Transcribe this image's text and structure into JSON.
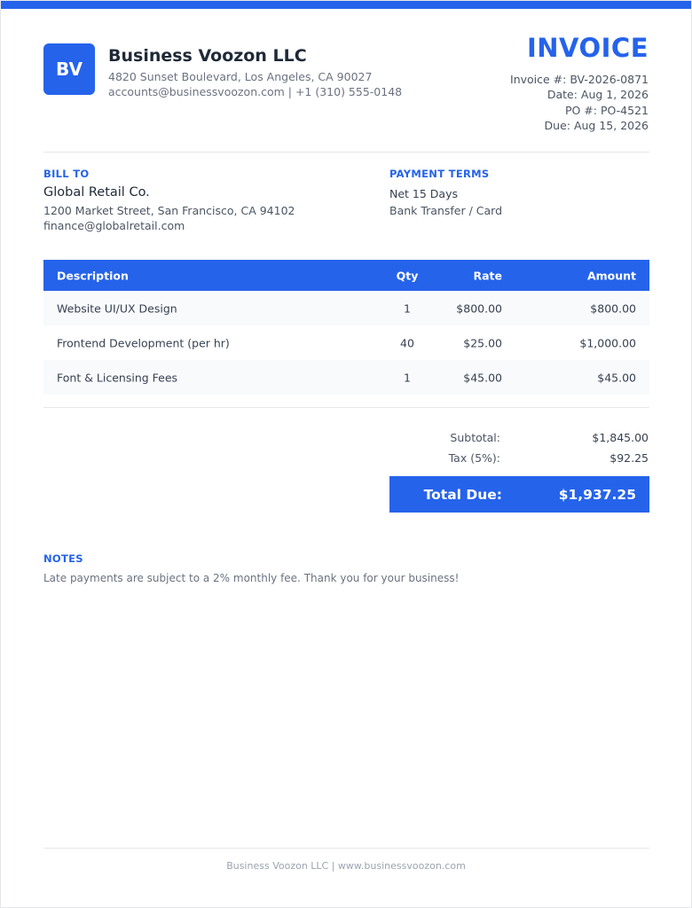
{
  "company": {
    "logo_initials": "BV",
    "name": "Business Voozon LLC",
    "address": "4820 Sunset Boulevard, Los Angeles, CA 90027",
    "contact": "accounts@businessvoozon.com | +1 (310) 555-0148"
  },
  "invoice": {
    "title": "INVOICE",
    "number": "Invoice #: BV-2026-0871",
    "date": "Date: Aug 1, 2026",
    "po": "PO #: PO-4521",
    "due": "Due: Aug 15, 2026"
  },
  "bill_to": {
    "label": "BILL TO",
    "name": "Global Retail Co.",
    "address": "1200 Market Street, San Francisco, CA 94102",
    "email": "finance@globalretail.com"
  },
  "payment_terms": {
    "label": "PAYMENT TERMS",
    "terms": "Net 15 Days",
    "method": "Bank Transfer / Card"
  },
  "table": {
    "headers": [
      "Description",
      "Qty",
      "Rate",
      "Amount"
    ],
    "rows": [
      {
        "description": "Website UI/UX Design",
        "qty": "1",
        "rate": "$800.00",
        "amount": "$800.00"
      },
      {
        "description": "Frontend Development (per hr)",
        "qty": "40",
        "rate": "$25.00",
        "amount": "$1,000.00"
      },
      {
        "description": "Font & Licensing Fees",
        "qty": "1",
        "rate": "$45.00",
        "amount": "$45.00"
      }
    ]
  },
  "summary": {
    "subtotal_label": "Subtotal:",
    "subtotal_value": "$1,845.00",
    "tax_label": "Tax (5%):",
    "tax_value": "$92.25",
    "total_label": "Total Due:",
    "total_value": "$1,937.25"
  },
  "notes": {
    "label": "NOTES",
    "text": "Late payments are subject to a 2% monthly fee. Thank you for your business!"
  },
  "footer": {
    "text": "Business Voozon LLC | www.businessvoozon.com"
  },
  "colors": {
    "accent": "#2563eb"
  }
}
